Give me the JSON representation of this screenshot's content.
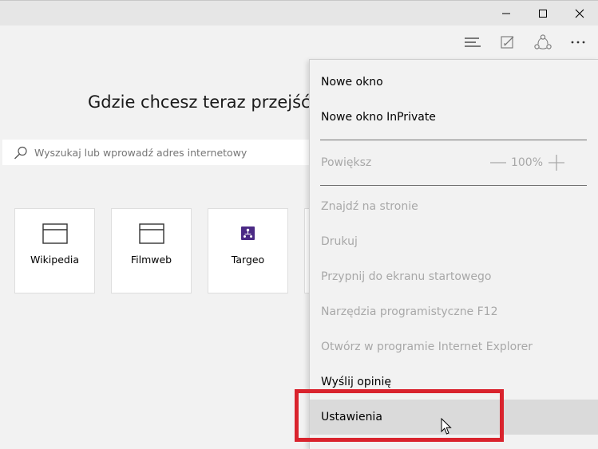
{
  "window": {
    "controls": {
      "minimize": "minimize-icon",
      "maximize": "maximize-icon",
      "close": "close-icon"
    }
  },
  "toolbar": {
    "icons": [
      "hub-icon",
      "web-note-icon",
      "share-icon",
      "more-icon"
    ]
  },
  "newtab": {
    "title": "Gdzie chcesz teraz przejść?",
    "search": {
      "placeholder": "Wyszukaj lub wprowadź adres internetowy",
      "icon": "search-icon"
    },
    "tiles": [
      {
        "label": "Wikipedia",
        "icon": "window-icon"
      },
      {
        "label": "Filmweb",
        "icon": "window-icon"
      },
      {
        "label": "Targeo",
        "icon": "targeo-logo-icon"
      }
    ]
  },
  "menu": {
    "new_window": "Nowe okno",
    "new_inprivate": "Nowe okno InPrivate",
    "zoom": {
      "label": "Powiększ",
      "value": "100%"
    },
    "find": "Znajdź na stronie",
    "print": "Drukuj",
    "pin": "Przypnij do ekranu startowego",
    "devtools": "Narzędzia programistyczne F12",
    "open_ie": "Otwórz w programie Internet Explorer",
    "feedback": "Wyślij opinię",
    "settings": "Ustawienia"
  },
  "colors": {
    "highlight": "#d9232d",
    "targeo_accent": "#4b2a85",
    "disabled_text": "#a8a8a8"
  }
}
